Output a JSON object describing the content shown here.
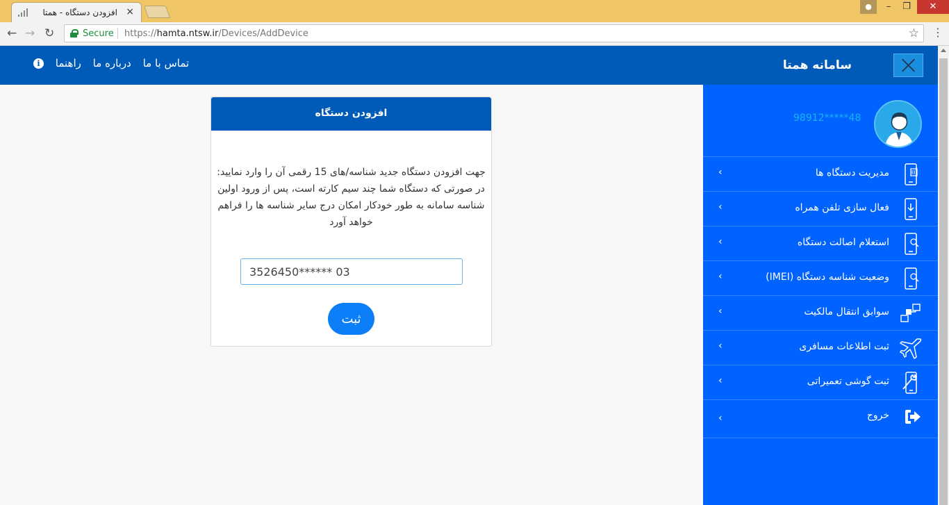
{
  "browser": {
    "tab_title": "افزودن دستگاه - همتا",
    "tab_close": "×",
    "secure_label": "Secure",
    "url_scheme": "https://",
    "url_host": "hamta.ntsw.ir",
    "url_path": "/Devices/AddDevice",
    "icons": [
      "back-arrow-icon",
      "forward-arrow-icon",
      "reload-icon",
      "lock-icon",
      "star-icon",
      "menu-dots-icon"
    ]
  },
  "header": {
    "app_title": "سامانه همتا",
    "links": [
      "راهنما",
      "درباره ما",
      "تماس با ما"
    ],
    "brand_color": "#005bb8"
  },
  "sidebar": {
    "phone": "98912*****48",
    "items": [
      {
        "label": "مدیریت دستگاه ها",
        "icon": "phone-manage-icon"
      },
      {
        "label": "فعال سازی تلفن همراه",
        "icon": "phone-download-icon"
      },
      {
        "label": "استعلام اصالت دستگاه",
        "icon": "phone-search-icon"
      },
      {
        "label": "وضعیت شناسه دستگاه (IMEI)",
        "icon": "phone-search-icon"
      },
      {
        "label": "سوابق انتقال مالکیت",
        "icon": "transfer-icon"
      },
      {
        "label": "ثبت اطلاعات مسافری",
        "icon": "airplane-icon"
      },
      {
        "label": "ثبت گوشی تعمیراتی",
        "icon": "repair-icon"
      },
      {
        "label": "خروج",
        "icon": "logout-icon"
      }
    ],
    "color": "#0062ff"
  },
  "card": {
    "title": "افزودن دستگاه",
    "line1": "جهت افزودن دستگاه جدید شناسه/های 15 رقمی آن را وارد نمایید:",
    "line2": "در صورتی که دستگاه شما چند سیم کارته است، پس از ورود اولین شناسه سامانه به طور خودکار امکان درج سایر شناسه ها را فراهم خواهد آورد",
    "imei_value": "3526450****** 03",
    "submit_label": "ثبت"
  }
}
